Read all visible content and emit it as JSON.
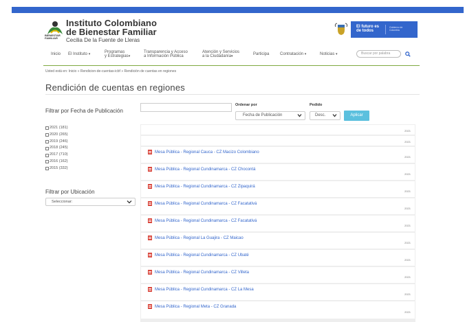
{
  "header": {
    "org_line1": "Instituto Colombiano",
    "org_line2": "de Bienestar Familiar",
    "org_sub": "Cecilia De la Fuente de Lleras",
    "logo_text": "BIENESTAR FAMILIAR",
    "gov_badge_main": "El futuro es de todos",
    "gov_badge_sub": "Gobierno de Colombia"
  },
  "nav": {
    "items": [
      {
        "label": "Inicio",
        "caret": ""
      },
      {
        "label": "El Instituto",
        "caret": "▾"
      },
      {
        "label": "Programas\ny Estrategias",
        "caret": "▾"
      },
      {
        "label": "Transparencia y Acceso\na Información Pública",
        "caret": ""
      },
      {
        "label": "Atención y Servicios\na la Ciudadanía",
        "caret": "▾"
      },
      {
        "label": "Participa",
        "caret": ""
      },
      {
        "label": "Contratación",
        "caret": "▾"
      },
      {
        "label": "Noticias",
        "caret": "▾"
      }
    ],
    "search_placeholder": "Buscar por palabra"
  },
  "breadcrumb": "Usted está en:   Inicio » Rendicion-de-cuentas-icbf » Rendición de cuentas en regiones",
  "page_title": "Rendición de cuentas en regiones",
  "filters": {
    "date_label": "Filtrar por Fecha de Publicación",
    "date_value": "",
    "order_label": "Ordenar por",
    "order_value": "Fecha de Publicación",
    "pedido_label": "Pedido",
    "pedido_value": "Desc.",
    "apply_label": "Aplicar",
    "years": [
      "2021 (181)",
      "2020 (265)",
      "2019 (246)",
      "2018 (245)",
      "2017 (710)",
      "2016 (162)",
      "2015 (332)"
    ],
    "location_label": "Filtrar por Ubicación",
    "location_value": "Seleccionar:"
  },
  "results": [
    {
      "title": "",
      "year": "2021"
    },
    {
      "title": "",
      "year": "2021"
    },
    {
      "title": "Mesa Pública - Regional Cauca - CZ Macizo Colombiano",
      "year": "2021"
    },
    {
      "title": "Mesa Pública - Regional Cundinamarca - CZ Chocontá",
      "year": "2021"
    },
    {
      "title": "Mesa Pública - Regional Cundinamarca - CZ Zipaquirá",
      "year": "2021"
    },
    {
      "title": "Mesa Pública - Regional Cundinamarca - CZ Facatativá",
      "year": "2021"
    },
    {
      "title": "Mesa Pública - Regional Cundinamarca - CZ Facatativá",
      "year": "2021"
    },
    {
      "title": "Mesa Pública - Regional La Guajira - CZ Maicao",
      "year": "2021"
    },
    {
      "title": "Mesa Pública - Regional Cundinamarca - CZ Ubaté",
      "year": "2021"
    },
    {
      "title": "Mesa Pública - Regional Cundinamarca - CZ Villeta",
      "year": "2021"
    },
    {
      "title": "Mesa Pública - Regional Cundinamarca - CZ La Mesa",
      "year": "2021"
    },
    {
      "title": "Mesa Pública - Regional Meta - CZ Granada",
      "year": "2021"
    }
  ],
  "colors": {
    "topbar": "#3366cc",
    "nav_underline": "#7ea940",
    "link": "#3366cc",
    "apply_button": "#5bc0de",
    "pdf_icon": "#d9453b"
  }
}
